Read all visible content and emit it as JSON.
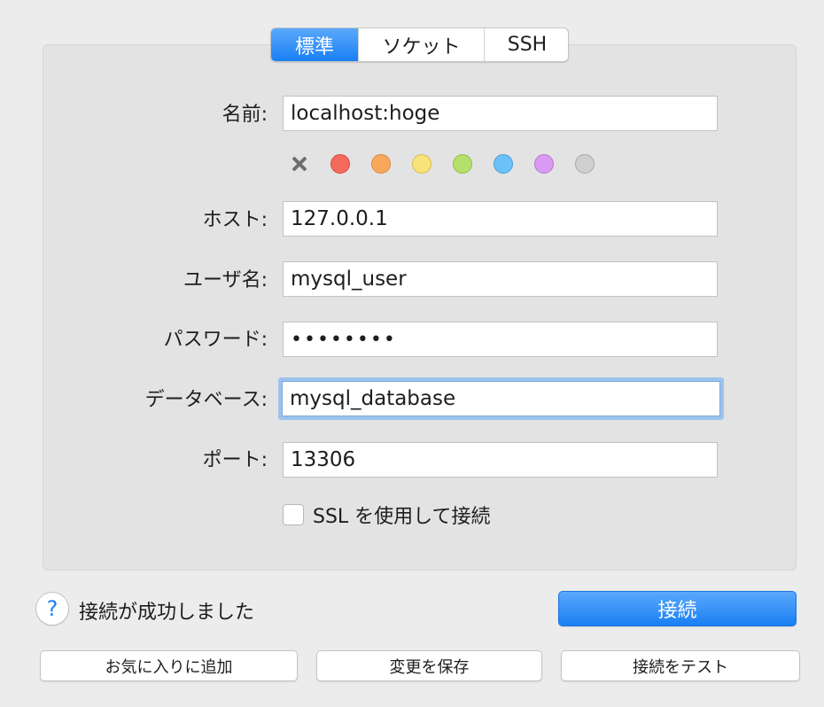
{
  "tabs": [
    {
      "label": "標準",
      "active": true
    },
    {
      "label": "ソケット",
      "active": false
    },
    {
      "label": "SSH",
      "active": false
    }
  ],
  "form": {
    "name": {
      "label": "名前:",
      "value": "localhost:hoge"
    },
    "host": {
      "label": "ホスト:",
      "value": "127.0.0.1"
    },
    "user": {
      "label": "ユーザ名:",
      "value": "mysql_user"
    },
    "password": {
      "label": "パスワード:",
      "value": "••••••••"
    },
    "database": {
      "label": "データベース:",
      "value": "mysql_database"
    },
    "port": {
      "label": "ポート:",
      "value": "13306"
    }
  },
  "colors": [
    {
      "name": "red",
      "fill": "#f46a5c",
      "border": "#d24c40"
    },
    {
      "name": "orange",
      "fill": "#f8a85a",
      "border": "#d9883e"
    },
    {
      "name": "yellow",
      "fill": "#f8e27a",
      "border": "#d5bd52"
    },
    {
      "name": "green",
      "fill": "#b5e06c",
      "border": "#8fbe4a"
    },
    {
      "name": "blue",
      "fill": "#6cc2f8",
      "border": "#4a9fd6"
    },
    {
      "name": "purple",
      "fill": "#d89af2",
      "border": "#b677d0"
    },
    {
      "name": "gray",
      "fill": "#cfcfcf",
      "border": "#a8a8a8"
    }
  ],
  "ssl_label": "SSL を使用して接続",
  "status_text": "接続が成功しました",
  "help_glyph": "?",
  "buttons": {
    "connect": "接続",
    "add_favorite": "お気に入りに追加",
    "save_changes": "変更を保存",
    "test_connection": "接続をテスト"
  }
}
